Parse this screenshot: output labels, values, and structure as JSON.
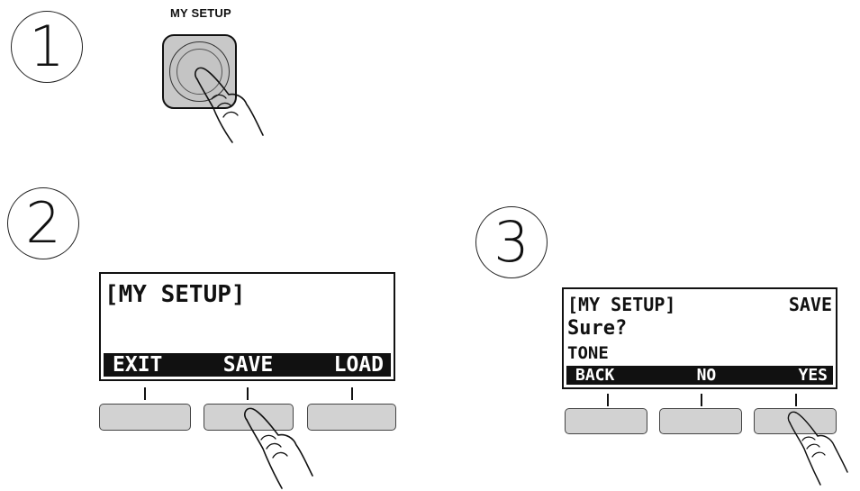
{
  "steps": {
    "one": "1",
    "two": "2",
    "three": "3"
  },
  "button_caption": "MY SETUP",
  "screen_main": {
    "title": "[MY SETUP]",
    "softkeys": [
      "EXIT",
      "SAVE",
      "LOAD"
    ]
  },
  "screen_confirm": {
    "title": "[MY SETUP]",
    "mode": "SAVE",
    "question": "Sure?",
    "item": "TONE",
    "softkeys": [
      "BACK",
      "NO",
      "YES"
    ]
  },
  "colors": {
    "button_fill": "#c8c8c8",
    "softkey_fill": "#d2d2d2",
    "ink": "#111111"
  },
  "icons": [
    "pointing-hand-icon"
  ]
}
